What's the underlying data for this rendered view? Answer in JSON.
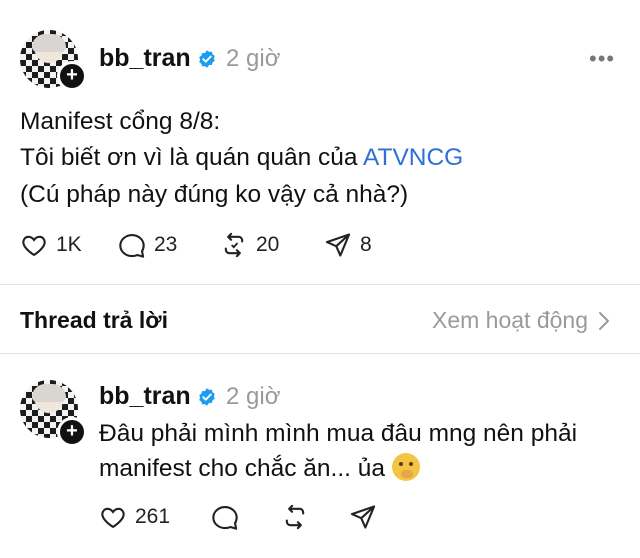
{
  "post": {
    "username": "bb_tran",
    "time": "2 giờ",
    "line1": "Manifest cổng 8/8:",
    "line2_prefix": "Tôi biết ơn vì là quán quân của ",
    "line2_link": "ATVNCG",
    "line3": "(Cú pháp này đúng ko vậy cả nhà?)",
    "likes": "1K",
    "comments": "23",
    "reposts": "20",
    "shares": "8"
  },
  "thread": {
    "title": "Thread trả lời",
    "see_activity": "Xem hoạt động"
  },
  "reply": {
    "username": "bb_tran",
    "time": "2 giờ",
    "line1": "Đâu phải mình mình mua đâu mng nên phải",
    "line2": "manifest cho chắc ăn... ủa",
    "likes": "261"
  },
  "icons": {
    "more": "more-horizontal-icon",
    "verified": "verified-badge-icon",
    "like": "heart-icon",
    "comment": "comment-bubble-icon",
    "repost": "repost-icon",
    "share": "send-icon",
    "chevron": "chevron-right-icon",
    "follow": "plus-icon"
  },
  "colors": {
    "verified": "#1d9bf0",
    "link": "#2f6fd6",
    "muted": "#9a9a9a"
  }
}
